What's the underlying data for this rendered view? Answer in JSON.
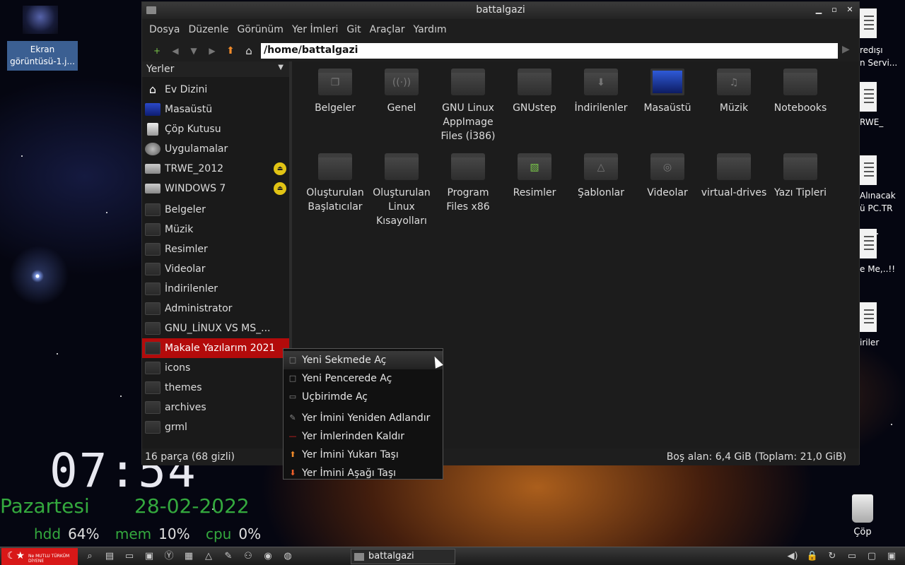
{
  "desktop": {
    "top_left_icon_label": "Ekran görüntüsü-1.j...",
    "right_labels": [
      "redışı",
      "n Servi...",
      "RWE_",
      "Alınacak",
      "ü PC.TR",
      "e Me,..!!",
      "iriler"
    ],
    "trash_label": "Çöp",
    "clock": "07:54",
    "day": "Pazartesi",
    "date": "28-02-2022",
    "stats": [
      {
        "label": "hdd",
        "value": "64%"
      },
      {
        "label": "mem",
        "value": "10%"
      },
      {
        "label": "cpu",
        "value": "0%"
      }
    ]
  },
  "window": {
    "title": "battalgazi",
    "controls": {
      "minimize": "▁",
      "maximize": "▫",
      "close": "✕"
    }
  },
  "menu": [
    "Dosya",
    "Düzenle",
    "Görünüm",
    "Yer İmleri",
    "Git",
    "Araçlar",
    "Yardım"
  ],
  "toolbar": {
    "path": "/home/battalgazi",
    "icons": {
      "new_tab": "+",
      "back": "◀",
      "dropdown": "▼",
      "forward": "▶",
      "up": "⬆",
      "home": "⌂",
      "go": "▶"
    }
  },
  "sidebar": {
    "header": "Yerler",
    "items": [
      {
        "label": "Ev Dizini",
        "icon": "home",
        "eject": false,
        "selected": false
      },
      {
        "label": "Masaüstü",
        "icon": "desktop",
        "eject": false,
        "selected": false
      },
      {
        "label": "Çöp Kutusu",
        "icon": "trash",
        "eject": false,
        "selected": false
      },
      {
        "label": "Uygulamalar",
        "icon": "applications",
        "eject": false,
        "selected": false
      },
      {
        "label": "TRWE_2012",
        "icon": "drive",
        "eject": true,
        "selected": false
      },
      {
        "label": "WINDOWS 7",
        "icon": "drive",
        "eject": true,
        "selected": false
      },
      {
        "label": "Belgeler",
        "icon": "folder",
        "eject": false,
        "selected": false
      },
      {
        "label": "Müzik",
        "icon": "folder",
        "eject": false,
        "selected": false
      },
      {
        "label": "Resimler",
        "icon": "folder",
        "eject": false,
        "selected": false
      },
      {
        "label": "Videolar",
        "icon": "folder",
        "eject": false,
        "selected": false
      },
      {
        "label": "İndirilenler",
        "icon": "folder",
        "eject": false,
        "selected": false
      },
      {
        "label": "Administrator",
        "icon": "folder",
        "eject": false,
        "selected": false
      },
      {
        "label": "GNU_LİNUX VS MS_...",
        "icon": "folder",
        "eject": false,
        "selected": false
      },
      {
        "label": "Makale Yazılarım 2021",
        "icon": "folder",
        "eject": false,
        "selected": true
      },
      {
        "label": "icons",
        "icon": "folder",
        "eject": false,
        "selected": false
      },
      {
        "label": "themes",
        "icon": "folder",
        "eject": false,
        "selected": false
      },
      {
        "label": "archives",
        "icon": "folder",
        "eject": false,
        "selected": false
      },
      {
        "label": "grml",
        "icon": "folder",
        "eject": false,
        "selected": false
      }
    ]
  },
  "files": [
    {
      "name": "Belgeler",
      "glyph": "❐"
    },
    {
      "name": "Genel",
      "glyph": "((·))"
    },
    {
      "name": "GNU Linux AppImage Files (İ386)",
      "glyph": ""
    },
    {
      "name": "GNUstep",
      "glyph": ""
    },
    {
      "name": "İndirilenler",
      "glyph": "⬇"
    },
    {
      "name": "Masaüstü",
      "glyph": "monitor"
    },
    {
      "name": "Müzik",
      "glyph": "♫"
    },
    {
      "name": "Notebooks",
      "glyph": ""
    },
    {
      "name": "Oluşturulan Başlatıcılar",
      "glyph": ""
    },
    {
      "name": "Oluşturulan Linux Kısayolları",
      "glyph": ""
    },
    {
      "name": "Program Files x86",
      "glyph": ""
    },
    {
      "name": "Resimler",
      "glyph": "▧"
    },
    {
      "name": "Şablonlar",
      "glyph": "△"
    },
    {
      "name": "Videolar",
      "glyph": "◎"
    },
    {
      "name": "virtual-drives",
      "glyph": ""
    },
    {
      "name": "Yazı Tipleri",
      "glyph": ""
    }
  ],
  "status": {
    "left": "16 parça (68 gizli)",
    "right": "Boş alan: 6,4 GiB (Toplam: 21,0 GiB)"
  },
  "context_menu": [
    {
      "label": "Yeni Sekmede Aç",
      "icon": "□",
      "hover": true,
      "sep_before": false
    },
    {
      "label": "Yeni Pencerede Aç",
      "icon": "□",
      "hover": false,
      "sep_before": false
    },
    {
      "label": "Uçbirimde Aç",
      "icon": "▭",
      "hover": false,
      "sep_before": false
    },
    {
      "label": "Yer İmini Yeniden Adlandır",
      "icon": "✎",
      "hover": false,
      "sep_before": true
    },
    {
      "label": "Yer İmlerinden Kaldır",
      "icon": "—",
      "hover": false,
      "sep_before": false
    },
    {
      "label": "Yer İmini Yukarı Taşı",
      "icon": "⬆",
      "hover": false,
      "sep_before": false
    },
    {
      "label": "Yer İmini Aşağı Taşı",
      "icon": "⬇",
      "hover": false,
      "sep_before": false
    }
  ],
  "taskbar": {
    "start_text": "Ne MUTLU TÜRKÜM DİYENE",
    "task_label": "battalgazi"
  }
}
